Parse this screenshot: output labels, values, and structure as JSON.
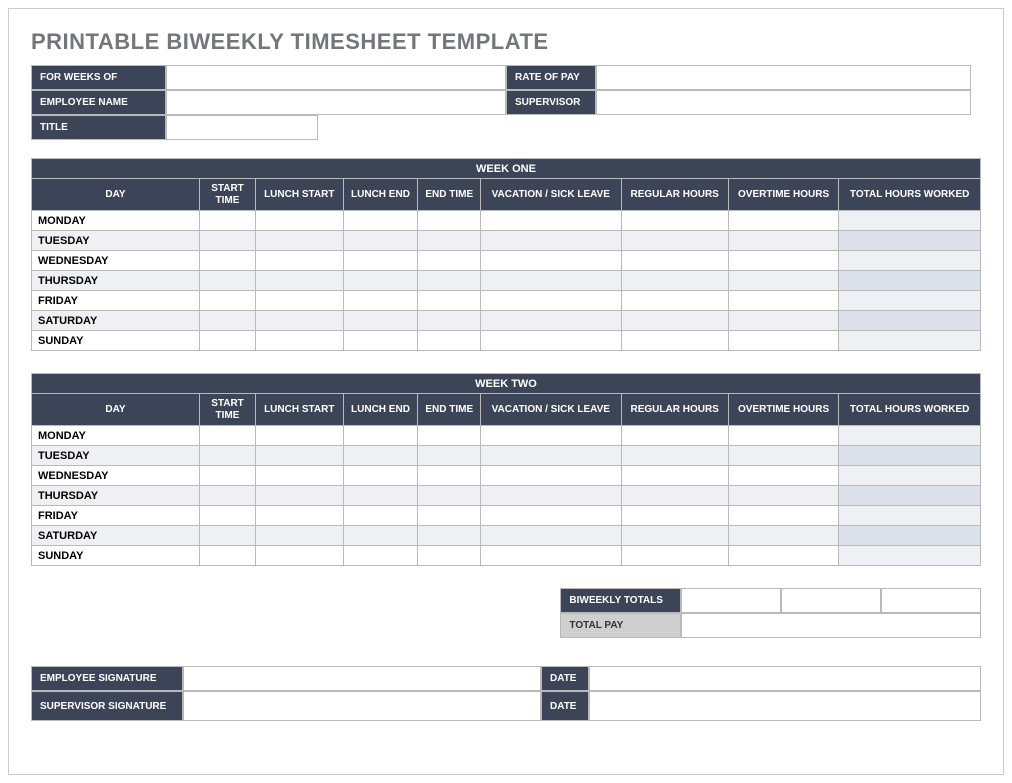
{
  "title": "PRINTABLE BIWEEKLY TIMESHEET TEMPLATE",
  "info": {
    "for_weeks_of_label": "FOR WEEKS OF",
    "for_weeks_of_value": "",
    "rate_of_pay_label": "RATE OF PAY",
    "rate_of_pay_value": "",
    "employee_name_label": "EMPLOYEE NAME",
    "employee_name_value": "",
    "supervisor_label": "SUPERVISOR",
    "supervisor_value": "",
    "title_label": "TITLE",
    "title_value": ""
  },
  "columns": {
    "day": "DAY",
    "start_time": "START TIME",
    "lunch_start": "LUNCH START",
    "lunch_end": "LUNCH END",
    "end_time": "END TIME",
    "vacation_sick": "VACATION / SICK LEAVE",
    "regular_hours": "REGULAR HOURS",
    "overtime_hours": "OVERTIME HOURS",
    "total_hours": "TOTAL HOURS WORKED"
  },
  "week_one": {
    "heading": "WEEK ONE",
    "rows": [
      {
        "day": "MONDAY",
        "start_time": "",
        "lunch_start": "",
        "lunch_end": "",
        "end_time": "",
        "vacation_sick": "",
        "regular_hours": "",
        "overtime_hours": "",
        "total_hours": ""
      },
      {
        "day": "TUESDAY",
        "start_time": "",
        "lunch_start": "",
        "lunch_end": "",
        "end_time": "",
        "vacation_sick": "",
        "regular_hours": "",
        "overtime_hours": "",
        "total_hours": ""
      },
      {
        "day": "WEDNESDAY",
        "start_time": "",
        "lunch_start": "",
        "lunch_end": "",
        "end_time": "",
        "vacation_sick": "",
        "regular_hours": "",
        "overtime_hours": "",
        "total_hours": ""
      },
      {
        "day": "THURSDAY",
        "start_time": "",
        "lunch_start": "",
        "lunch_end": "",
        "end_time": "",
        "vacation_sick": "",
        "regular_hours": "",
        "overtime_hours": "",
        "total_hours": ""
      },
      {
        "day": "FRIDAY",
        "start_time": "",
        "lunch_start": "",
        "lunch_end": "",
        "end_time": "",
        "vacation_sick": "",
        "regular_hours": "",
        "overtime_hours": "",
        "total_hours": ""
      },
      {
        "day": "SATURDAY",
        "start_time": "",
        "lunch_start": "",
        "lunch_end": "",
        "end_time": "",
        "vacation_sick": "",
        "regular_hours": "",
        "overtime_hours": "",
        "total_hours": ""
      },
      {
        "day": "SUNDAY",
        "start_time": "",
        "lunch_start": "",
        "lunch_end": "",
        "end_time": "",
        "vacation_sick": "",
        "regular_hours": "",
        "overtime_hours": "",
        "total_hours": ""
      }
    ]
  },
  "week_two": {
    "heading": "WEEK TWO",
    "rows": [
      {
        "day": "MONDAY",
        "start_time": "",
        "lunch_start": "",
        "lunch_end": "",
        "end_time": "",
        "vacation_sick": "",
        "regular_hours": "",
        "overtime_hours": "",
        "total_hours": ""
      },
      {
        "day": "TUESDAY",
        "start_time": "",
        "lunch_start": "",
        "lunch_end": "",
        "end_time": "",
        "vacation_sick": "",
        "regular_hours": "",
        "overtime_hours": "",
        "total_hours": ""
      },
      {
        "day": "WEDNESDAY",
        "start_time": "",
        "lunch_start": "",
        "lunch_end": "",
        "end_time": "",
        "vacation_sick": "",
        "regular_hours": "",
        "overtime_hours": "",
        "total_hours": ""
      },
      {
        "day": "THURSDAY",
        "start_time": "",
        "lunch_start": "",
        "lunch_end": "",
        "end_time": "",
        "vacation_sick": "",
        "regular_hours": "",
        "overtime_hours": "",
        "total_hours": ""
      },
      {
        "day": "FRIDAY",
        "start_time": "",
        "lunch_start": "",
        "lunch_end": "",
        "end_time": "",
        "vacation_sick": "",
        "regular_hours": "",
        "overtime_hours": "",
        "total_hours": ""
      },
      {
        "day": "SATURDAY",
        "start_time": "",
        "lunch_start": "",
        "lunch_end": "",
        "end_time": "",
        "vacation_sick": "",
        "regular_hours": "",
        "overtime_hours": "",
        "total_hours": ""
      },
      {
        "day": "SUNDAY",
        "start_time": "",
        "lunch_start": "",
        "lunch_end": "",
        "end_time": "",
        "vacation_sick": "",
        "regular_hours": "",
        "overtime_hours": "",
        "total_hours": ""
      }
    ]
  },
  "totals": {
    "biweekly_totals_label": "BIWEEKLY TOTALS",
    "biweekly_reg": "",
    "biweekly_ot": "",
    "biweekly_total": "",
    "total_pay_label": "TOTAL PAY",
    "total_pay_value": ""
  },
  "signatures": {
    "employee_signature_label": "EMPLOYEE SIGNATURE",
    "employee_signature_value": "",
    "supervisor_signature_label": "SUPERVISOR SIGNATURE",
    "supervisor_signature_value": "",
    "date_label": "DATE",
    "employee_date_value": "",
    "supervisor_date_value": ""
  }
}
